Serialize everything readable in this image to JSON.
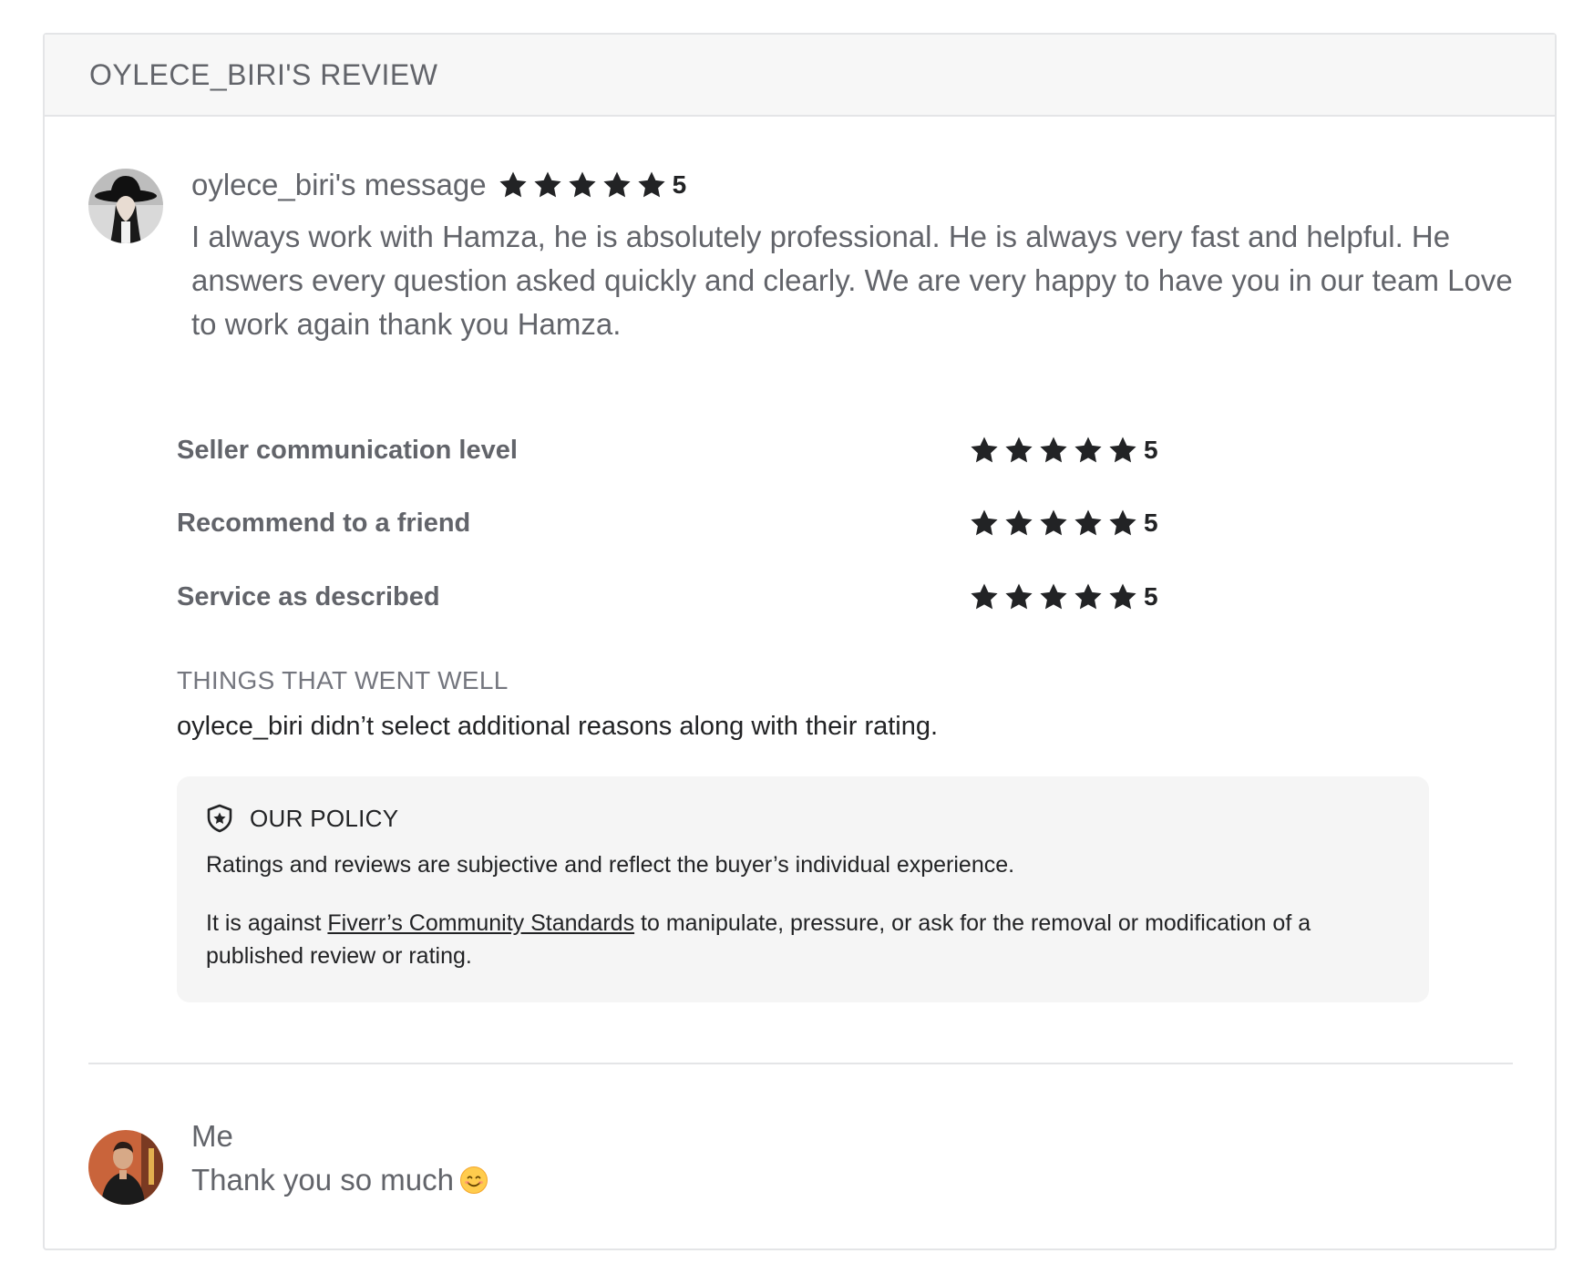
{
  "review": {
    "title": "OYLECE_BIRI'S REVIEW"
  },
  "message": {
    "author": "oylece_biri's message",
    "rating": "5",
    "text": "I always work with Hamza, he is absolutely professional. He is always very fast and helpful. He answers every question asked quickly and clearly. We are very happy to have you in our team Love to work again thank you Hamza."
  },
  "ratings": [
    {
      "label": "Seller communication level",
      "value": "5"
    },
    {
      "label": "Recommend to a friend",
      "value": "5"
    },
    {
      "label": "Service as described",
      "value": "5"
    }
  ],
  "went_well": {
    "title": "THINGS THAT WENT WELL",
    "text": "oylece_biri didn’t select additional reasons along with their rating."
  },
  "policy": {
    "title": "OUR POLICY",
    "line1": "Ratings and reviews are subjective and reflect the buyer’s individual experience.",
    "line2_prefix": "It is against ",
    "link": "Fiverr’s Community Standards",
    "line2_suffix": " to manipulate, pressure, or ask for the removal or modification of a published review or rating."
  },
  "reply": {
    "author": "Me",
    "text": "Thank you so much"
  },
  "icons": {
    "star": "star-icon",
    "policy": "shield-star-icon",
    "emoji": "smiling-face-emoji"
  },
  "colors": {
    "star": "#222325",
    "text": "#62646a",
    "header_bg": "#f7f7f7",
    "policy_bg": "#f5f5f5"
  }
}
